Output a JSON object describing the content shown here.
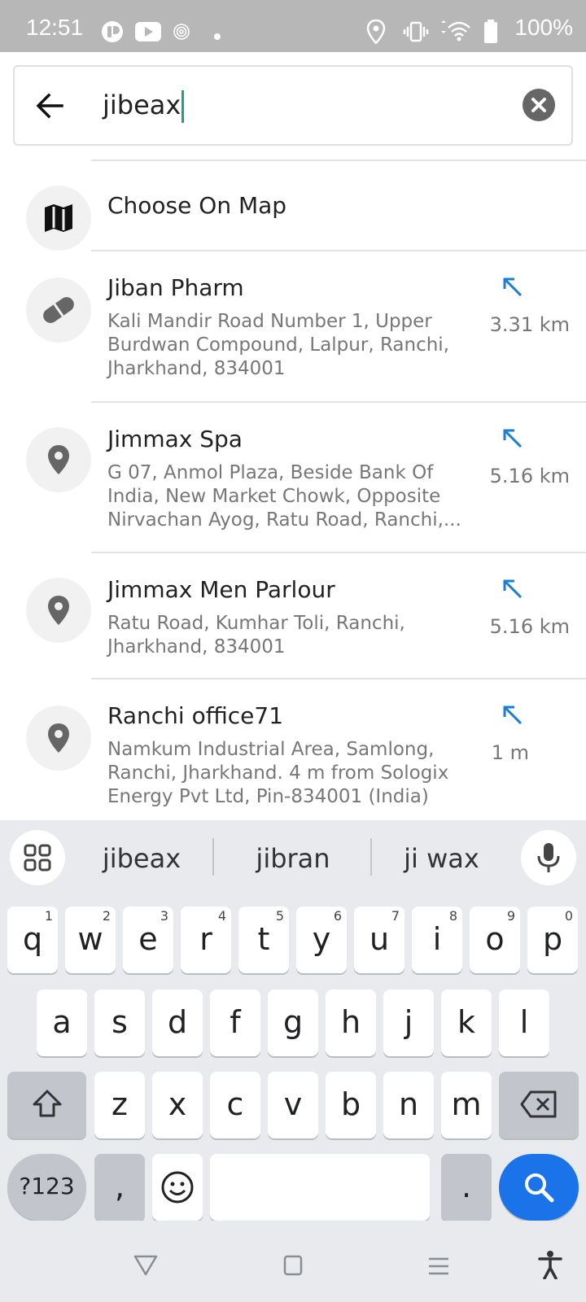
{
  "status_bar": {
    "time": "12:51",
    "battery": "100%",
    "icons": [
      "app-icon",
      "youtube-icon",
      "fingerprint-icon",
      "dot-icon",
      "location-icon",
      "vibrate-icon",
      "wifi-icon",
      "battery-icon"
    ]
  },
  "search": {
    "query": "jibeax",
    "back_icon": "arrow-back-icon",
    "clear_icon": "clear-icon"
  },
  "results": [
    {
      "icon": "map-icon",
      "title": "Choose On Map"
    },
    {
      "icon": "pill-icon",
      "title": "Jiban Pharm",
      "address": "Kali Mandir Road Number 1, Upper Burdwan Compound, Lalpur, Ranchi, Jharkhand, 834001",
      "distance": "3.31 km"
    },
    {
      "icon": "pin-icon",
      "title": "Jimmax Spa",
      "address": "G 07, Anmol Plaza, Beside Bank Of India, New Market Chowk, Opposite Nirvachan Ayog, Ratu Road, Ranchi,...",
      "distance": "5.16 km"
    },
    {
      "icon": "pin-icon",
      "title": "Jimmax Men Parlour",
      "address": "Ratu Road, Kumhar Toli, Ranchi, Jharkhand, 834001",
      "distance": "5.16 km"
    },
    {
      "icon": "pin-icon",
      "title": "Ranchi office71",
      "address": "Namkum Industrial Area, Samlong, Ranchi, Jharkhand. 4 m from Sologix Energy Pvt Ltd, Pin-834001 (India)",
      "distance": "1 m"
    }
  ],
  "keyboard": {
    "suggestions": [
      "jibeax",
      "jibran",
      "ji wax"
    ],
    "row1": [
      "q",
      "w",
      "e",
      "r",
      "t",
      "y",
      "u",
      "i",
      "o",
      "p"
    ],
    "row1_hints": [
      "1",
      "2",
      "3",
      "4",
      "5",
      "6",
      "7",
      "8",
      "9",
      "0"
    ],
    "row2": [
      "a",
      "s",
      "d",
      "f",
      "g",
      "h",
      "j",
      "k",
      "l"
    ],
    "row3": [
      "z",
      "x",
      "c",
      "v",
      "b",
      "n",
      "m"
    ],
    "symbols_key": "?123",
    "comma_key": ",",
    "period_key": ".",
    "accent_color": "#1a73e8"
  }
}
